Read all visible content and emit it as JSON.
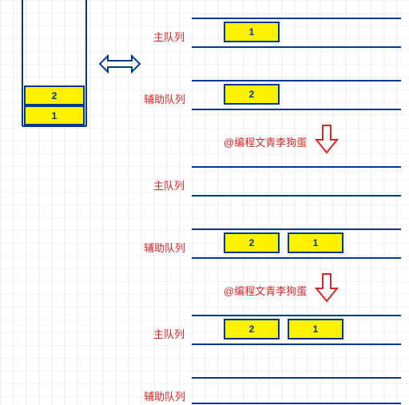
{
  "labels": {
    "mainQueue": "主队列",
    "auxQueue": "辅助队列"
  },
  "watermark": "@编程文青李狗蛋",
  "stack": {
    "top": "2",
    "bottom": "1"
  },
  "step1": {
    "mainBox": "1",
    "auxBox": "2"
  },
  "step2": {
    "box1": "2",
    "box2": "1"
  },
  "step3": {
    "box1": "2",
    "box2": "1"
  },
  "colors": {
    "line": "#003a8c",
    "box": "#fff200",
    "accent": "#d62728"
  }
}
